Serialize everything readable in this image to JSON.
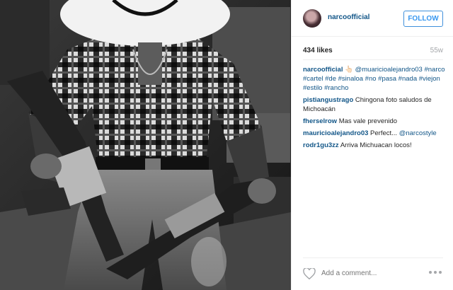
{
  "post": {
    "username": "narcoofficial",
    "follow_label": "FOLLOW",
    "likes": "434 likes",
    "age": "55w",
    "caption": {
      "user": "narcoofficial",
      "emoji": "👆🏻",
      "mention": "@muaricioalejandro03",
      "hashtags": "#narco #cartel #de #sinaloa #no #pasa #nada #viejon #estilo #rancho"
    },
    "comments": [
      {
        "user": "pistiangustrago",
        "text": "Chingona foto saludos de Michoacán"
      },
      {
        "user": "fherselrow",
        "text": "Mas vale prevenido"
      },
      {
        "user": "mauricioalejandro03",
        "text": "Perfect...",
        "mention": "@narcostyle"
      },
      {
        "user": "rodr1gu3zz",
        "text": "Arriva Michuacan locos!"
      }
    ],
    "add_comment_placeholder": "Add a comment..."
  },
  "icons": {
    "heart": "heart-icon",
    "more": "more-options-icon",
    "avatar": "avatar"
  },
  "colors": {
    "username": "#125688",
    "follow": "#3897f0",
    "muted": "#a5a7aa"
  }
}
